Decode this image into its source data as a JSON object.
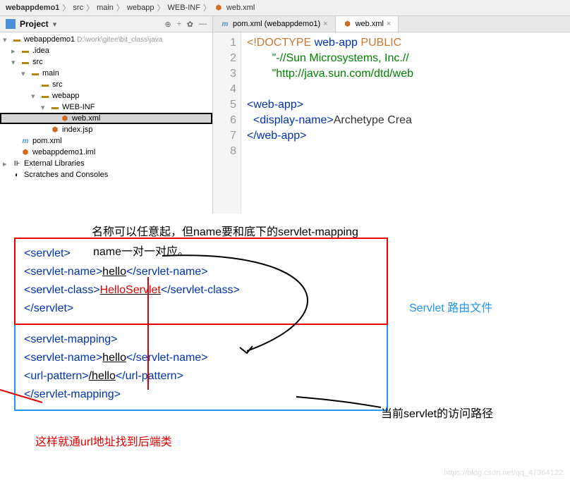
{
  "breadcrumb": [
    "webappdemo1",
    "src",
    "main",
    "webapp",
    "WEB-INF",
    "web.xml"
  ],
  "project_panel": {
    "title": "Project"
  },
  "tree": {
    "root": "webappdemo1",
    "root_path": "D:\\work\\gitee\\bit_class\\java",
    "idea": ".idea",
    "src": "src",
    "main": "main",
    "src2": "src",
    "webapp": "webapp",
    "webinf": "WEB-INF",
    "webxml": "web.xml",
    "indexjsp": "index.jsp",
    "pom": "pom.xml",
    "iml": "webappdemo1.iml",
    "ext": "External Libraries",
    "scratch": "Scratches and Consoles"
  },
  "tabs": {
    "pom": "pom.xml (webappdemo1)",
    "web": "web.xml"
  },
  "code": {
    "l1a": "<!DOCTYPE ",
    "l1b": "web-app ",
    "l1c": "PUBLIC",
    "l2": "\"-//Sun Microsystems, Inc.//",
    "l3": "\"http://java.sun.com/dtd/web",
    "l5": "<web-app>",
    "l6a": "<display-name>",
    "l6b": "Archetype Crea",
    "l7": "</web-app>"
  },
  "anno": {
    "top_text": "名称可以任意起，但name要和底下的servlet-mapping",
    "name_match": "name一对一对应。",
    "blue_label": "Servlet 路由文件",
    "path_label": "当前servlet的访问路径",
    "bottom_red": "这样就通url地址找到后端类"
  },
  "servlet": {
    "open": "<servlet>",
    "name_open": "<servlet-name>",
    "name_val": "hello",
    "name_close": "</servlet-name>",
    "class_open": "<servlet-class>",
    "class_val": "HelloServlet",
    "class_close": "</servlet-class>",
    "close": "</servlet>"
  },
  "mapping": {
    "open": "<servlet-mapping>",
    "name_open": "<servlet-name>",
    "name_val": "hello",
    "name_close": "</servlet-name>",
    "url_open": "<url-pattern>",
    "url_val": "/hello",
    "url_close": "</url-pattern>",
    "close": "</servlet-mapping>"
  },
  "watermark": "https://blog.csdn.net/qq_47364122"
}
